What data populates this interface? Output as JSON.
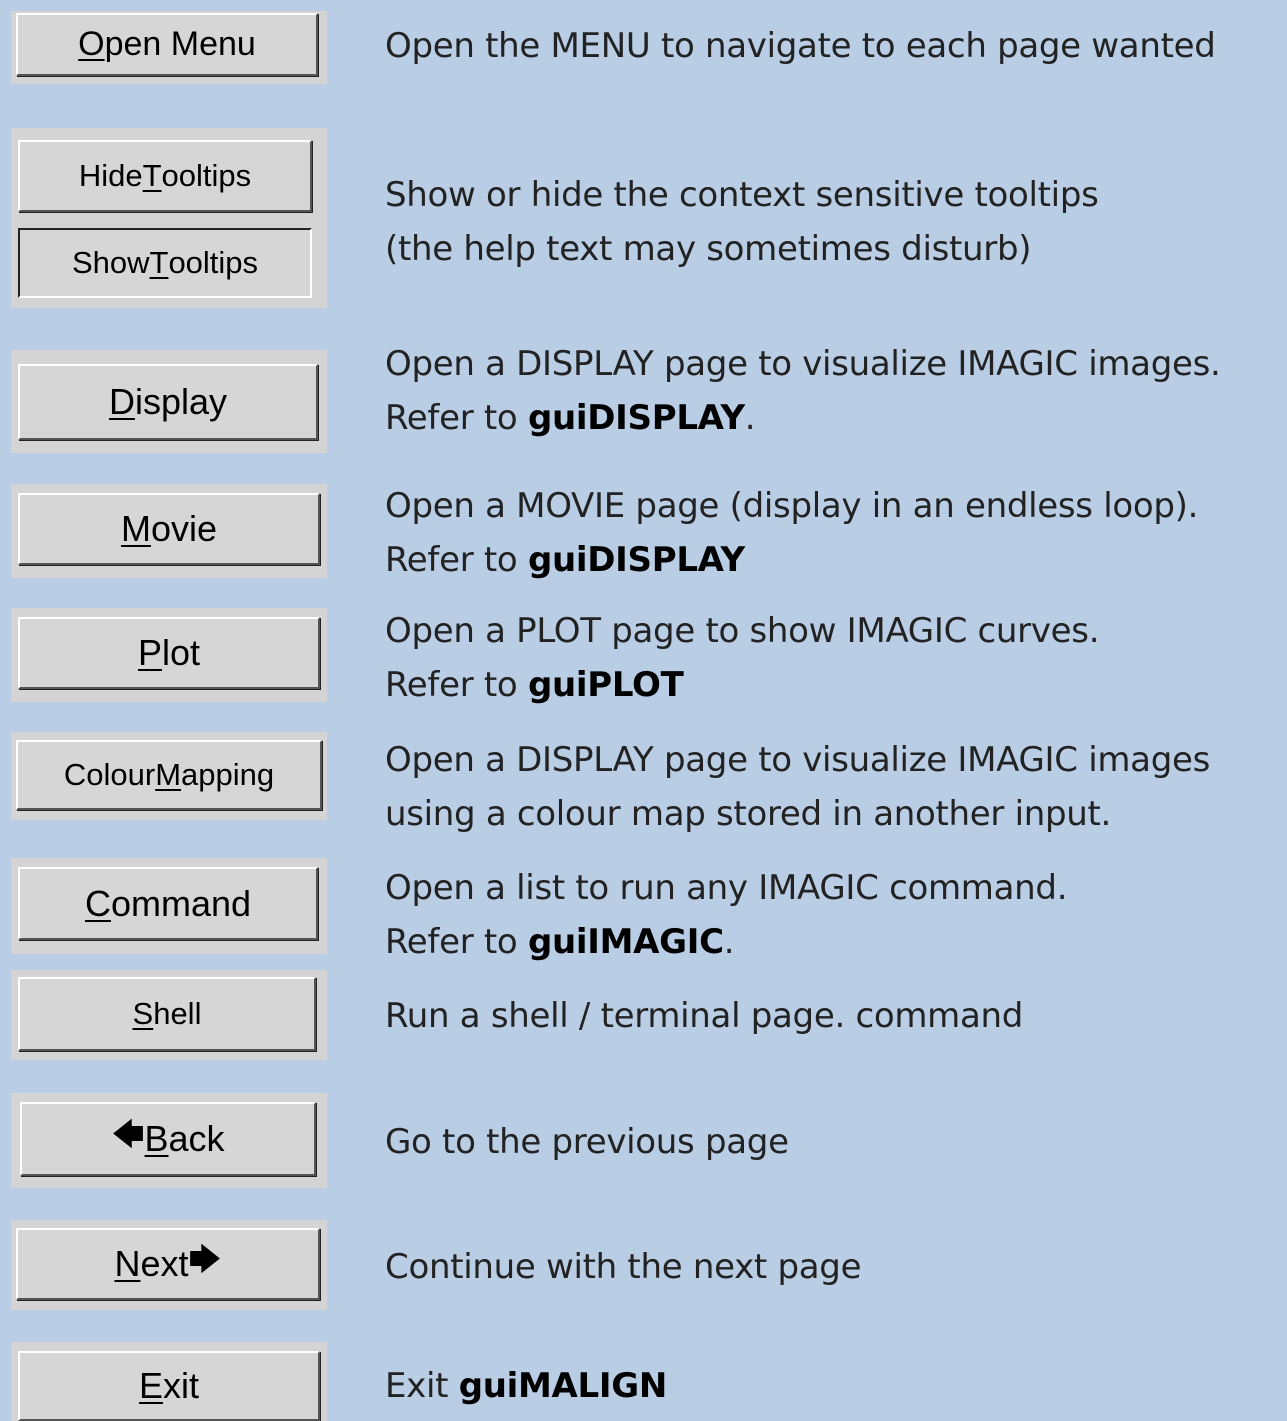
{
  "colors": {
    "background": "#b9cde5",
    "button_face": "#d6d6d6",
    "panel": "#d4d4d4"
  },
  "items": [
    {
      "button": {
        "pre": "",
        "u": "O",
        "post": "pen Menu"
      },
      "desc": {
        "line1": "Open the MENU to navigate to each page wanted"
      }
    },
    {
      "button": {
        "pre": "Hide ",
        "u": "T",
        "post": "ooltips"
      },
      "button2": {
        "pre": "Show ",
        "u": "T",
        "post": "ooltips"
      },
      "desc": {
        "line1": "Show or hide the context sensitive tooltips",
        "line2": "(the help text may sometimes disturb)"
      }
    },
    {
      "button": {
        "pre": "",
        "u": "D",
        "post": "isplay"
      },
      "desc": {
        "line1": "Open a DISPLAY page to visualize IMAGIC images.",
        "line2_pre": "Refer to ",
        "line2_bold": "guiDISPLAY",
        "line2_post": "."
      }
    },
    {
      "button": {
        "pre": "",
        "u": "M",
        "post": "ovie"
      },
      "desc": {
        "line1": "Open a MOVIE page (display in an endless loop).",
        "line2_pre": "Refer to ",
        "line2_bold": "guiDISPLAY",
        "line2_post": ""
      }
    },
    {
      "button": {
        "pre": "",
        "u": "P",
        "post": "lot"
      },
      "desc": {
        "line1": "Open a PLOT page to show IMAGIC curves.",
        "line2_pre": "Refer to ",
        "line2_bold": "guiPLOT",
        "line2_post": ""
      }
    },
    {
      "button": {
        "pre": "Colour ",
        "u": "M",
        "post": "apping"
      },
      "desc": {
        "line1": "Open a DISPLAY page to visualize IMAGIC images",
        "line2": "using a colour map stored in another input."
      }
    },
    {
      "button": {
        "pre": "",
        "u": "C",
        "post": "ommand"
      },
      "desc": {
        "line1": "Open a list to run any IMAGIC command.",
        "line2_pre": "Refer to ",
        "line2_bold": "guiIMAGIC",
        "line2_post": "."
      }
    },
    {
      "button": {
        "pre": "",
        "u": "S",
        "post": "hell"
      },
      "desc": {
        "line1": "Run a shell / terminal page. command"
      }
    },
    {
      "button": {
        "arrow_left": "🡄",
        "pre": "",
        "u": "B",
        "post": "ack"
      },
      "desc": {
        "line1": "Go to the previous page"
      }
    },
    {
      "button": {
        "pre": "",
        "u": "N",
        "post": "ext",
        "arrow_right": "🡆"
      },
      "desc": {
        "line1": "Continue with the next page"
      }
    },
    {
      "button": {
        "pre": "",
        "u": "E",
        "post": "xit"
      },
      "desc": {
        "line1_pre": "Exit ",
        "line1_bold": "guiMALIGN"
      }
    }
  ]
}
